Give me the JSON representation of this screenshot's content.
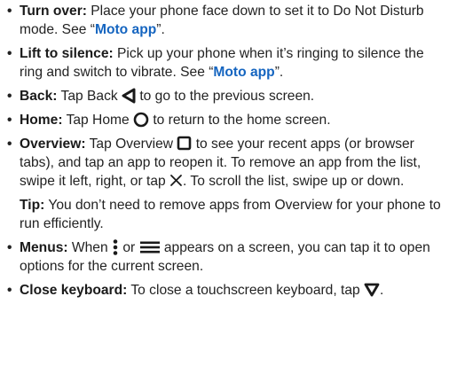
{
  "items": [
    {
      "term": "Turn over:",
      "before": " Place your phone face down to set it to Do Not Disturb mode. See “",
      "link": "Moto app",
      "after": "”."
    },
    {
      "term": "Lift to silence:",
      "before": " Pick up your phone when it’s ringing to silence the ring and switch to vibrate. See “",
      "link": "Moto app",
      "after": "”."
    },
    {
      "term": "Back:",
      "before": " Tap Back ",
      "icon": "back-triangle-icon",
      "after": " to go to the previous screen."
    },
    {
      "term": "Home:",
      "before": " Tap Home ",
      "icon": "home-circle-icon",
      "after": " to return to the home screen."
    },
    {
      "term": "Overview:",
      "before": " Tap Overview ",
      "icon": "overview-square-icon",
      "middle": " to see your recent apps (or browser tabs), and tap an app to reopen it. To remove an app from the list, swipe it left, right, or tap ",
      "icon2": "close-x-icon",
      "after": ". To scroll the list, swipe up or down."
    },
    {
      "term": "Menus:",
      "before": " When ",
      "icon": "vertical-dots-menu-icon",
      "middle": " or ",
      "icon2": "hamburger-menu-icon",
      "after": " appears on a screen, you can tap it to open options for the current screen."
    },
    {
      "term": "Close keyboard:",
      "before": " To close a touchscreen keyboard, tap ",
      "icon": "keyboard-down-triangle-icon",
      "after": "."
    }
  ],
  "tip": {
    "label": "Tip:",
    "text": " You don’t need to remove apps from Overview for your phone to run efficiently."
  },
  "bullet_char": "•",
  "colors": {
    "text": "#222222",
    "link": "#1565c0",
    "icon": "#1a1a1a"
  }
}
